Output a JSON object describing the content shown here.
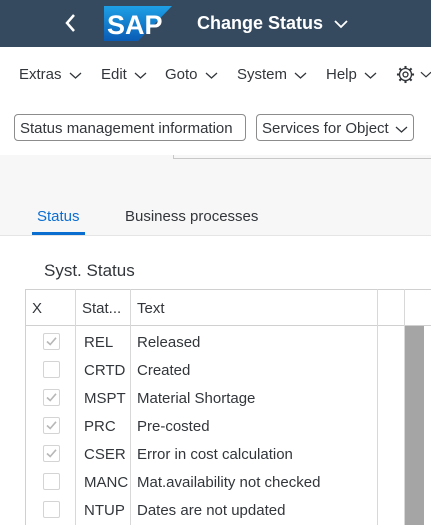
{
  "shell": {
    "back_icon": "chevron-left-icon",
    "logo_text": "SAP",
    "title": "Change Status",
    "title_icon": "chevron-down-icon"
  },
  "menu": {
    "items": [
      {
        "label": "Extras"
      },
      {
        "label": "Edit"
      },
      {
        "label": "Goto"
      },
      {
        "label": "System"
      },
      {
        "label": "Help"
      }
    ],
    "settings_icon": "gear-icon"
  },
  "toolbar": {
    "status_info_label": "Status management information",
    "services_label": "Services for Object"
  },
  "tabs": [
    {
      "label": "Status",
      "active": true
    },
    {
      "label": "Business processes",
      "active": false
    }
  ],
  "section": {
    "title": "Syst. Status"
  },
  "table": {
    "columns": [
      "X",
      "Stat...",
      "Text"
    ],
    "rows": [
      {
        "checked": true,
        "code": "REL",
        "text": "Released"
      },
      {
        "checked": false,
        "code": "CRTD",
        "text": "Created"
      },
      {
        "checked": true,
        "code": "MSPT",
        "text": "Material Shortage"
      },
      {
        "checked": true,
        "code": "PRC",
        "text": "Pre-costed"
      },
      {
        "checked": true,
        "code": "CSER",
        "text": "Error in cost calculation"
      },
      {
        "checked": false,
        "code": "MANC",
        "text": "Mat.availability not checked"
      },
      {
        "checked": false,
        "code": "NTUP",
        "text": "Dates are not updated"
      }
    ]
  },
  "colors": {
    "shell_bg": "#354a5f",
    "accent": "#0a6ed1",
    "sap_logo_blue": "#0a6ed1"
  }
}
